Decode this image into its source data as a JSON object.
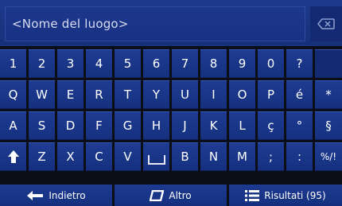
{
  "search": {
    "placeholder": "<Nome del luogo>"
  },
  "icons": {
    "backspace": "backspace-icon",
    "shift": "shift-arrow-icon",
    "space": "space-bar-icon",
    "back": "left-arrow-icon",
    "other": "map-shape-icon",
    "results": "list-icon"
  },
  "rows": [
    [
      "1",
      "2",
      "3",
      "4",
      "5",
      "6",
      "7",
      "8",
      "9",
      "0",
      "?",
      ""
    ],
    [
      "Q",
      "W",
      "E",
      "R",
      "T",
      "Y",
      "U",
      "I",
      "O",
      "P",
      "é",
      "*"
    ],
    [
      "A",
      "S",
      "D",
      "F",
      "G",
      "H",
      "J",
      "K",
      "L",
      "ç",
      "°",
      "§"
    ],
    [
      "",
      "Z",
      "X",
      "C",
      "V",
      "",
      "B",
      "N",
      "M",
      ";",
      ":",
      "%/!"
    ]
  ],
  "bottom": {
    "back_label": "Indietro",
    "other_label": "Altro",
    "results_label": "Risultati (95)"
  },
  "colors": {
    "key": "#1a3588",
    "bar": "#1f3a8c",
    "background": "#0b0d17"
  }
}
